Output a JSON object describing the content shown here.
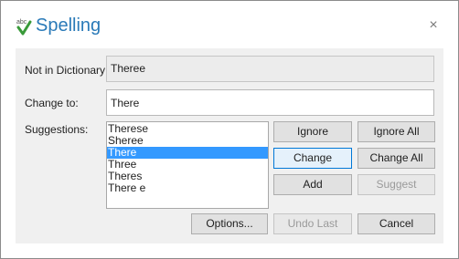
{
  "window": {
    "title": "Spelling",
    "close_glyph": "×",
    "icon": "spell-check-icon",
    "title_color": "#2a7ab8"
  },
  "not_in_dictionary": {
    "label": "Not in Dictionary:",
    "value": "Theree"
  },
  "change_to": {
    "label": "Change to:",
    "value": "There"
  },
  "suggestions": {
    "label": "Suggestions:",
    "items": [
      "Therese",
      "Sheree",
      "There",
      "Three",
      "Theres",
      "There e"
    ],
    "selected_index": 2
  },
  "buttons": {
    "ignore": "Ignore",
    "ignore_all": "Ignore All",
    "change": "Change",
    "change_all": "Change All",
    "add": "Add",
    "suggest": "Suggest",
    "options": "Options...",
    "undo_last": "Undo Last",
    "cancel": "Cancel"
  },
  "colors": {
    "selection": "#3399ff",
    "default_button_border": "#0078d7"
  }
}
